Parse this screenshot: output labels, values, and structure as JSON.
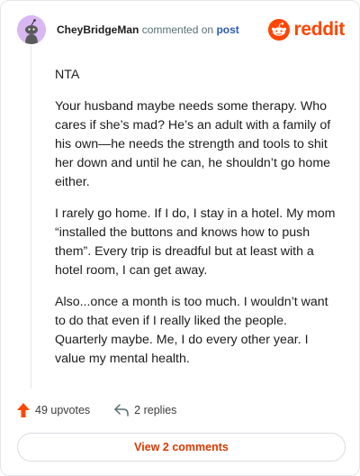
{
  "header": {
    "author": "CheyBridgeMan",
    "action_text": "commented on",
    "post_link": "post",
    "brand": "reddit"
  },
  "comment": {
    "paragraphs": [
      "NTA",
      "Your husband maybe needs some therapy. Who cares if she’s mad? He’s an adult with a family of his own—he needs the strength and tools to shit her down and until he can, he shouldn’t go home either.",
      "I rarely go home. If I do, I stay in a hotel. My mom “installed the buttons and knows how to push them”. Every trip is dreadful but at least with a hotel room, I can get away.",
      "Also...once a month is too much. I wouldn’t want to do that even if I really liked the people. Quarterly maybe. Me, I do every other year. I value my mental health."
    ]
  },
  "actions": {
    "upvotes_label": "49 upvotes",
    "replies_label": "2 replies"
  },
  "footer": {
    "view_comments_label": "View 2 comments"
  },
  "colors": {
    "brand": "#ff4500",
    "upvote_arrow": "#ff4500",
    "link": "#2a5db0",
    "view_button_text": "#d93a00",
    "avatar_bg": "#d9b8f2"
  },
  "icons": {
    "avatar": "snoo-avatar-icon",
    "brand": "reddit-logo-icon",
    "upvote": "upvote-arrow-icon",
    "reply": "reply-arrow-icon"
  }
}
